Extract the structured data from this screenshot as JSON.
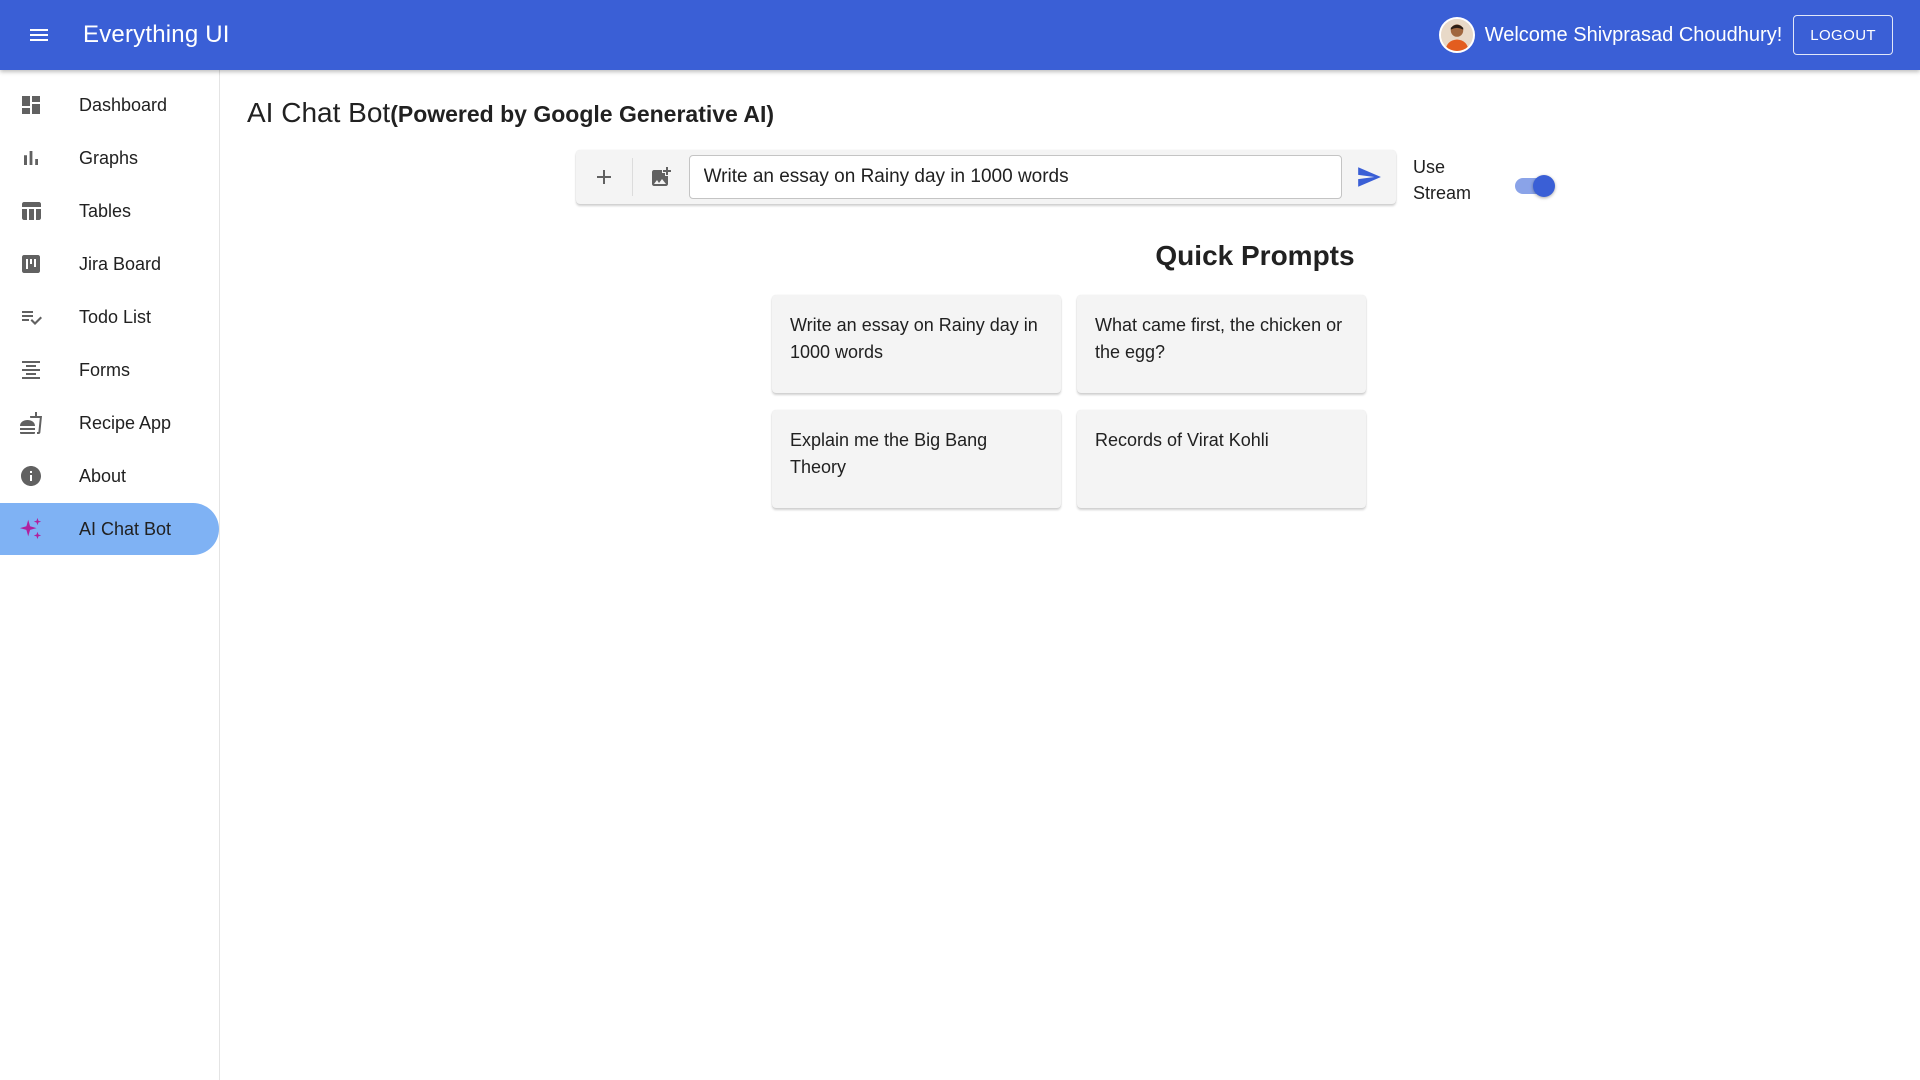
{
  "app": {
    "title": "Everything UI",
    "welcome_text": "Welcome Shivprasad Choudhury!",
    "logout_label": "LOGOUT",
    "accent_color": "#3a5fd6"
  },
  "sidebar": {
    "items": [
      {
        "label": "Dashboard",
        "icon": "dashboard-icon"
      },
      {
        "label": "Graphs",
        "icon": "bar-chart-icon"
      },
      {
        "label": "Tables",
        "icon": "table-icon"
      },
      {
        "label": "Jira Board",
        "icon": "kanban-board-icon"
      },
      {
        "label": "Todo List",
        "icon": "checklist-icon"
      },
      {
        "label": "Forms",
        "icon": "align-center-icon"
      },
      {
        "label": "Recipe App",
        "icon": "recipe-icon"
      },
      {
        "label": "About",
        "icon": "info-icon"
      },
      {
        "label": "AI Chat Bot",
        "icon": "sparkle-icon",
        "active": true
      }
    ],
    "active_color": "#7fb2f4"
  },
  "main": {
    "title": "AI Chat Bot",
    "title_suffix": "(Powered by Google Generative AI)",
    "prompt_value": "Write an essay on Rainy day in 1000 words",
    "stream_label": "Use Stream",
    "stream_enabled": true,
    "quick_prompts_title": "Quick Prompts",
    "quick_prompts": [
      "Write an essay on Rainy day in 1000 words",
      "What came first, the chicken or the egg?",
      "Explain me the Big Bang Theory",
      "Records of Virat Kohli"
    ]
  }
}
